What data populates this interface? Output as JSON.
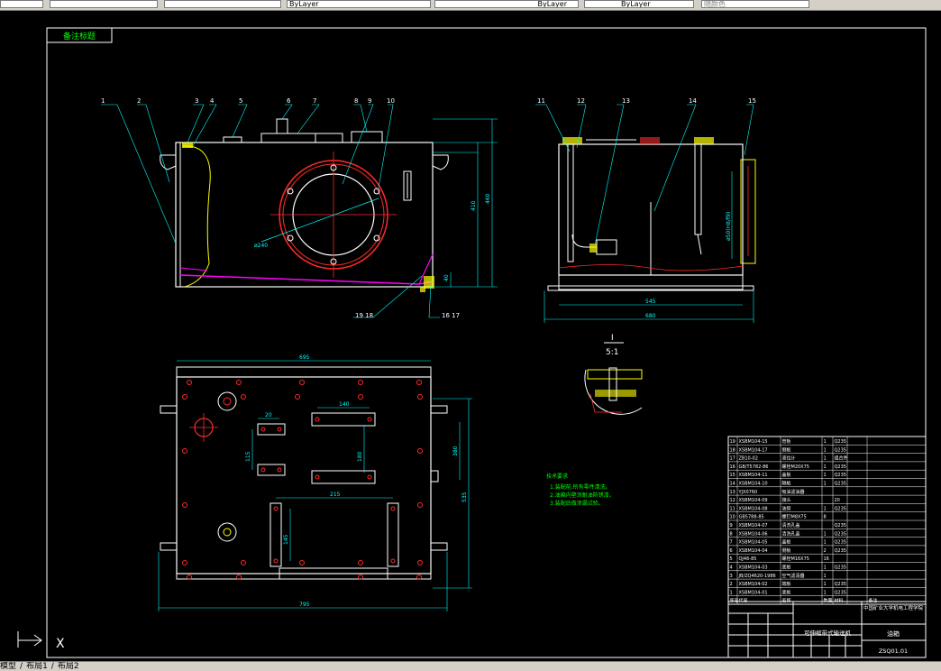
{
  "toolbar": {
    "linetype_value": "ByLayer",
    "color_value": "ByLayer",
    "lineweight_value": "ByLayer",
    "plotstyle_value": "随颜色"
  },
  "colors": {
    "background": "#000000",
    "line_white": "#ffffff",
    "dim_cyan": "#00ffff",
    "leader_green": "#00ff00",
    "center_red": "#ff2a2a",
    "section_yellow": "#ffff00",
    "accent_magenta": "#ff00ff"
  },
  "drawing": {
    "frame_label": "备注标题",
    "balloons": [
      "1",
      "2",
      "3",
      "4",
      "5",
      "6",
      "7",
      "8",
      "9",
      "10",
      "11",
      "12",
      "13",
      "14",
      "15",
      "16",
      "17",
      "18",
      "19"
    ],
    "bottom_balloons": {
      "left": "19 18",
      "right": "16 17"
    },
    "front_dims": {
      "height_total": "460",
      "height_inner": "410",
      "low": "40",
      "diameter": "ø240"
    },
    "side_dims": {
      "bottom_width": "545",
      "overall_width": "680",
      "vertical": "ø50(H8/f9)"
    },
    "plan_dims": {
      "top": "695",
      "bottom": "795",
      "right1": "380",
      "right2": "535",
      "slot1": "140",
      "slot2": "180",
      "small1": "20",
      "small2": "115",
      "lower_span": "215",
      "lower_v": "145"
    },
    "detail": {
      "mark": "I",
      "scale": "5:1"
    },
    "notes_title": "技术要求",
    "notes": [
      "1.装配前,所有零件清洗。",
      "2.油箱内壁涂耐油防锈漆。",
      "3.装配后做渗漏试验。"
    ],
    "bom_rows": [
      {
        "no": "19",
        "code": "XSBM104-15",
        "name": "管板",
        "qty": "1",
        "mat": "Q235"
      },
      {
        "no": "18",
        "code": "XSBM104-17",
        "name": "侧板",
        "qty": "1",
        "mat": "Q235"
      },
      {
        "no": "17",
        "code": "ZB10-02",
        "name": "液位计",
        "qty": "1",
        "mat": "组合件"
      },
      {
        "no": "16",
        "code": "GB/T5782-86",
        "name": "螺栓M20X75",
        "qty": "1",
        "mat": "Q235"
      },
      {
        "no": "15",
        "code": "XSBM104-11",
        "name": "盖板",
        "qty": "1",
        "mat": "Q235"
      },
      {
        "no": "14",
        "code": "XSBM104-10",
        "name": "隔板",
        "qty": "1",
        "mat": "Q235"
      },
      {
        "no": "13",
        "code": "YJX0760",
        "name": "吸油滤油器",
        "qty": "",
        "mat": ""
      },
      {
        "no": "12",
        "code": "XSBM104-09",
        "name": "接头",
        "qty": "",
        "mat": "20"
      },
      {
        "no": "11",
        "code": "XSBM104-08",
        "name": "油管",
        "qty": "1",
        "mat": "Q235"
      },
      {
        "no": "10",
        "code": "GB5788-85",
        "name": "螺钉M8X75",
        "qty": "8",
        "mat": ""
      },
      {
        "no": "9",
        "code": "XSBM104-07",
        "name": "清洗孔盖",
        "qty": "",
        "mat": "Q235"
      },
      {
        "no": "8",
        "code": "XSBM104-06",
        "name": "清洗孔盖",
        "qty": "1",
        "mat": "Q235"
      },
      {
        "no": "7",
        "code": "XSBM104-05",
        "name": "盖板",
        "qty": "1",
        "mat": "Q235"
      },
      {
        "no": "6",
        "code": "XSBM104-04",
        "name": "侧板",
        "qty": "2",
        "mat": "Q235"
      },
      {
        "no": "5",
        "code": "QJ46-85",
        "name": "螺栓M16X75",
        "qty": "16",
        "mat": ""
      },
      {
        "no": "4",
        "code": "XSBM104-03",
        "name": "底板",
        "qty": "1",
        "mat": "Q235"
      },
      {
        "no": "3",
        "code": "JB/ZQ4620-1986",
        "name": "空气滤清器",
        "qty": "1",
        "mat": ""
      },
      {
        "no": "2",
        "code": "XSBM104-02",
        "name": "端板",
        "qty": "1",
        "mat": "Q235"
      },
      {
        "no": "1",
        "code": "XSBM104-01",
        "name": "底板",
        "qty": "1",
        "mat": "Q235"
      }
    ],
    "bom_header": [
      "序号",
      "代号",
      "名称",
      "数量",
      "材料",
      "",
      "备注"
    ],
    "title_block": {
      "school": "中国矿业大学机电工程学院",
      "product": "可伸缩带式输送机",
      "part": "油箱",
      "drawing_no": "ZSQ01.01"
    }
  },
  "ucs": {
    "axis_label": "X"
  },
  "tabs": [
    "模型",
    "布局1",
    "布局2"
  ]
}
